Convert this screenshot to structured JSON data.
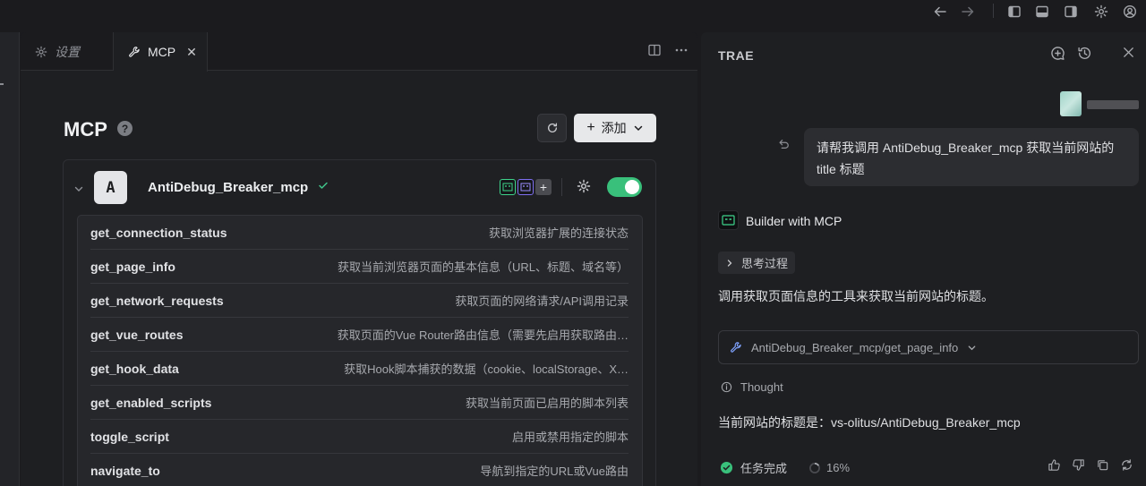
{
  "icons": {
    "back": "arrow-left-icon",
    "forward": "arrow-right-icon",
    "toggle_left": "toggle-left-sidebar-icon",
    "toggle_bottom": "toggle-bottom-panel-icon",
    "toggle_right": "toggle-right-sidebar-icon",
    "settings": "gear-icon",
    "account": "account-icon"
  },
  "editor": {
    "tabs": [
      {
        "label": "设置",
        "icon": "gear-icon",
        "active": false
      },
      {
        "label": "MCP",
        "icon": "wrench-icon",
        "active": true
      }
    ],
    "title": "MCP",
    "help_glyph": "?",
    "add_label": "添加",
    "server": {
      "avatar_letter": "A",
      "name": "AntiDebug_Breaker_mcp",
      "enabled": true,
      "tools": [
        {
          "name": "get_connection_status",
          "desc": "获取浏览器扩展的连接状态"
        },
        {
          "name": "get_page_info",
          "desc": "获取当前浏览器页面的基本信息（URL、标题、域名等）"
        },
        {
          "name": "get_network_requests",
          "desc": "获取页面的网络请求/API调用记录"
        },
        {
          "name": "get_vue_routes",
          "desc": "获取页面的Vue Router路由信息（需要先启用获取路由…"
        },
        {
          "name": "get_hook_data",
          "desc": "获取Hook脚本捕获的数据（cookie、localStorage、X…"
        },
        {
          "name": "get_enabled_scripts",
          "desc": "获取当前页面已启用的脚本列表"
        },
        {
          "name": "toggle_script",
          "desc": "启用或禁用指定的脚本"
        },
        {
          "name": "navigate_to",
          "desc": "导航到指定的URL或Vue路由"
        }
      ]
    }
  },
  "chat": {
    "title": "TRAE",
    "user_message": "请帮我调用 AntiDebug_Breaker_mcp 获取当前网站的 title 标题",
    "agent_name": "Builder with MCP",
    "thinking_label": "思考过程",
    "reply_1": "调用获取页面信息的工具来获取当前网站的标题。",
    "tool_call": "AntiDebug_Breaker_mcp/get_page_info",
    "thought_label": "Thought",
    "reply_2": "当前网站的标题是：vs-olitus/AntiDebug_Breaker_mcp",
    "status_done": "任务完成",
    "progress_text": "16%",
    "progress": 0.16
  },
  "colors": {
    "accent_green": "#39c07b",
    "background": "#1b1b1e",
    "panel": "#1e1f22"
  }
}
